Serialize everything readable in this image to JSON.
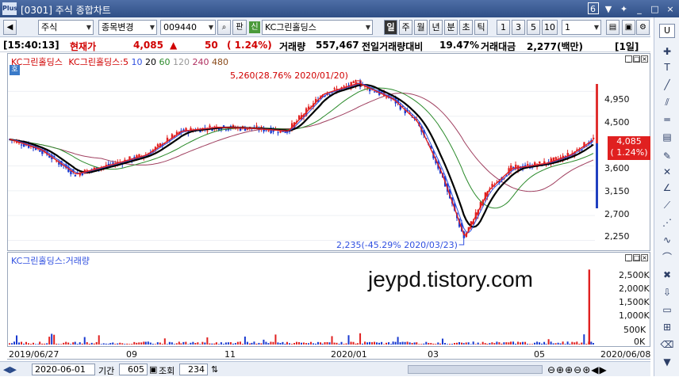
{
  "window": {
    "title": "[0301] 주식 종합차트",
    "logo": "Plus",
    "screen_no": "6",
    "controls": [
      "▼",
      "✦",
      "_",
      "□",
      "×"
    ]
  },
  "toolbar": {
    "market": "주식",
    "change_item": "종목변경",
    "code": "009440",
    "search_icon": "search-icon",
    "stock_name_badge": "신",
    "stock_name": "KC그린홀딩스",
    "mode_label": "판",
    "periods": [
      "일",
      "주",
      "월",
      "년",
      "분",
      "초",
      "틱"
    ],
    "active_period": "일",
    "intervals": [
      "1",
      "3",
      "5",
      "10"
    ],
    "interval_value": "1"
  },
  "quote": {
    "time": "[15:40:13]",
    "label": "현재가",
    "price": "4,085",
    "arrow": "▲",
    "change": "50",
    "change_pct": "( 1.24%)",
    "volume_label": "거래량",
    "volume": "557,467",
    "prev_vol_label": "전일거래량대비",
    "prev_vol_pct": "19.47%",
    "amount_label": "거래대금",
    "amount": "2,277(백만)",
    "period_tag": "[1일]"
  },
  "price_panel": {
    "tag": "호",
    "legend_name": "KC그린홀딩스",
    "legend_ma": "KC그린홀딩스:5",
    "ma_periods": [
      "10",
      "20",
      "60",
      "120",
      "240",
      "480"
    ],
    "high_annotation": "5,260(28.76% 2020/01/20)",
    "low_annotation": "2,235(-45.29% 2020/03/23)",
    "price_ticks": [
      "4,950",
      "4,500",
      "3,600",
      "3,150",
      "2,700",
      "2,250"
    ],
    "current_price_box": "4,085",
    "current_pct_box": "( 1.24%)"
  },
  "volume_panel": {
    "legend": "KC그린홀딩스:거래량",
    "watermark": "jeypd.tistory.com",
    "volume_ticks": [
      "2,500K",
      "2,000K",
      "1,500K",
      "1,000K",
      "500K",
      "0K"
    ]
  },
  "x_axis": {
    "labels": [
      "2019/06/27",
      "09",
      "11",
      "2020/01",
      "03",
      "05",
      "2020/06/08"
    ]
  },
  "bottom": {
    "date": "2020-06-01",
    "period_label": "기간",
    "period_value": "605",
    "query_label": "조회",
    "query_value": "234"
  },
  "chart_data": {
    "type": "candlestick",
    "x_range": [
      "2019/06/27",
      "2020/06/08"
    ],
    "price_ylim": [
      2100,
      5400
    ],
    "volume_ylim_k": [
      0,
      2800
    ],
    "points": [
      {
        "date": "2019/06/27",
        "close": 4080
      },
      {
        "date": "2019/07/15",
        "close": 3900
      },
      {
        "date": "2019/08/05",
        "close": 3450
      },
      {
        "date": "2019/08/26",
        "close": 3620
      },
      {
        "date": "2019/09/16",
        "close": 3800
      },
      {
        "date": "2019/10/07",
        "close": 4230
      },
      {
        "date": "2019/10/28",
        "close": 4300
      },
      {
        "date": "2019/11/18",
        "close": 4280
      },
      {
        "date": "2019/12/09",
        "close": 4230
      },
      {
        "date": "2019/12/30",
        "close": 4900
      },
      {
        "date": "2020/01/20",
        "close": 5100
      },
      {
        "date": "2020/02/10",
        "close": 4800
      },
      {
        "date": "2020/02/24",
        "close": 4400
      },
      {
        "date": "2020/03/09",
        "close": 3500
      },
      {
        "date": "2020/03/23",
        "close": 2300
      },
      {
        "date": "2020/04/06",
        "close": 3150
      },
      {
        "date": "2020/04/20",
        "close": 3550
      },
      {
        "date": "2020/05/11",
        "close": 3650
      },
      {
        "date": "2020/05/25",
        "close": 3800
      },
      {
        "date": "2020/06/08",
        "close": 4085
      }
    ],
    "volume_spike": {
      "date": "2020/06/05",
      "volume_k": 2650
    }
  }
}
